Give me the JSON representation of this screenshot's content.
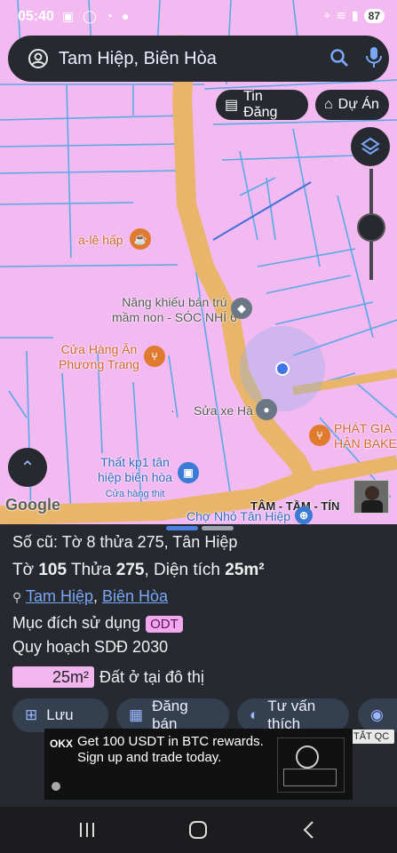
{
  "status": {
    "time": "05:40",
    "left_icons": "▣ ◯ ◔ ●",
    "battery": "87"
  },
  "search": {
    "query": "Tam Hiệp, Biên Hòa"
  },
  "chips": {
    "listing": "Tin Đăng",
    "project": "Dự Án"
  },
  "map": {
    "labels": {
      "cafe": "a-lê hấp",
      "school_line1": "Năng khiếu bán trú",
      "school_line2": "mầm non - SÓC NHÍ 6",
      "restaurant_line1": "Cửa Hàng Ăn",
      "restaurant_line2": "Phương Trang",
      "repair": "Sửa xe Hà",
      "bake_line1": "PHÁT GIA",
      "bake_line2": "HÂN BAKE",
      "meat_line1": "Thất kp1 tân",
      "meat_line2": "hiệp biên hòa",
      "meat_sub": "Cửa hàng thịt",
      "market": "Chợ Nhỏ Tân Hiệp",
      "realtor": "TÂM - TẦM - TÍN",
      "google": "Google"
    }
  },
  "panel": {
    "old_info": "Số cũ: Tờ 8 thửa 275, Tân Hiệp",
    "sheet_label": "Tờ ",
    "sheet_value": "105",
    "parcel_label": " Thửa ",
    "parcel_value": "275",
    "area_label": ", Diện tích ",
    "area_value": "25m²",
    "location_ward": "Tam Hiệp",
    "location_city": "Biên Hòa",
    "purpose_label": "Mục đích sử dụng",
    "purpose_value": "ODT",
    "plan_label": "Quy hoạch SDĐ 2030",
    "plan_area": "25m²",
    "plan_type": "Đất ở tại đô thị",
    "buttons": {
      "save": "Lưu",
      "post": "Đăng bán",
      "contact": "Tư vấn thích"
    },
    "ad_close": "TẮT QC"
  },
  "ad": {
    "brand": "OKX",
    "line1": "Get 100 USDT in BTC rewards.",
    "line2": "Sign up and trade today."
  },
  "colors": {
    "parcel": "#f3b9f1",
    "road": "#e8b56a",
    "boundary": "#58a9e6",
    "panel": "#262a30",
    "accent": "#79a7f5"
  }
}
